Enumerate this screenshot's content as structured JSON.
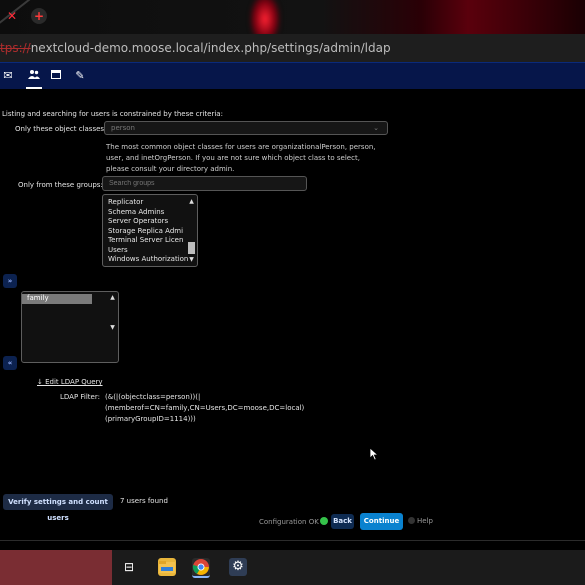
{
  "browser": {
    "url_scheme": "tps://",
    "url_rest": "nextcloud-demo.moose.local/index.php/settings/admin/ldap",
    "tab_close_icon": "close-icon",
    "new_tab_icon": "plus-icon"
  },
  "header_icons": [
    "mail-icon",
    "contacts-icon",
    "calendar-icon",
    "edit-icon"
  ],
  "intro": "Listing and searching for users is constrained by these criteria:",
  "object_classes": {
    "label": "Only these object classes:",
    "value": "person",
    "help_line1": "The most common object classes for users are organizationalPerson, person,",
    "help_line2": "user, and inetOrgPerson. If you are not sure which object class to select,",
    "help_line3": "please consult your directory admin."
  },
  "groups": {
    "label": "Only from these groups:",
    "search_placeholder": "Search groups",
    "available": [
      "Replicator",
      "Schema Admins",
      "Server Operators",
      "Storage Replica Admi",
      "Terminal Server Licen",
      "Users",
      "Windows Authorization"
    ],
    "add_label": "»",
    "remove_label": "«",
    "selected": [
      "family"
    ]
  },
  "query": {
    "edit_link": "↓ Edit LDAP Query",
    "filter_label": "LDAP Filter:",
    "filter_line1": "(&(|(objectclass=person))(|",
    "filter_line2": "(memberof=CN=family,CN=Users,DC=moose,DC=local)",
    "filter_line3": "(primaryGroupID=1114)))"
  },
  "footer": {
    "verify_button": "Verify settings and count users",
    "users_found": "7 users found",
    "config_status": "Configuration OK",
    "back_button": "Back",
    "continue_button": "Continue",
    "help_label": "Help"
  },
  "colors": {
    "status_ok": "#35c24a",
    "primary": "#0a82cf",
    "nav_bg": "#06164a"
  },
  "taskbar_icons": [
    "task-view-icon",
    "file-explorer-icon",
    "chrome-icon",
    "settings-icon"
  ]
}
